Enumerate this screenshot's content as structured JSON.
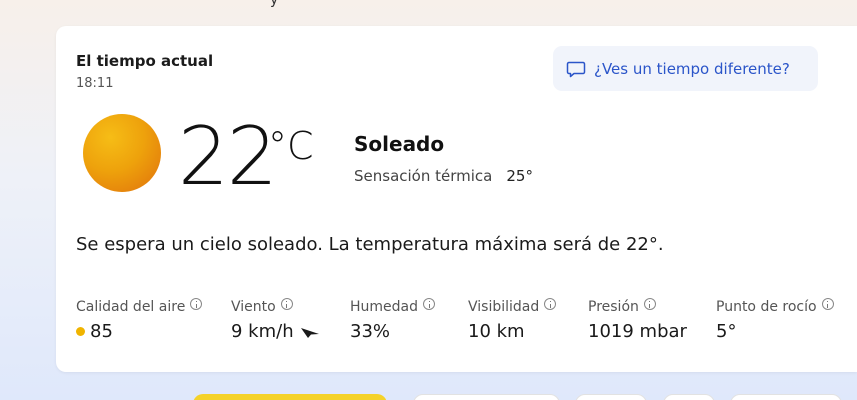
{
  "top_fragment": "y",
  "weather": {
    "title": "El tiempo actual",
    "time": "18:11",
    "feedback_label": "¿Ves un tiempo diferente?",
    "temperature": "22",
    "unit": "°C",
    "condition": "Soleado",
    "feels_like_label": "Sensación térmica",
    "feels_like_value": "25°",
    "summary": "Se espera un cielo soleado. La temperatura máxima será de 22°.",
    "icon": "sun-icon"
  },
  "metrics": [
    {
      "label": "Calidad del aire",
      "value": "85"
    },
    {
      "label": "Viento",
      "value": "9 km/h"
    },
    {
      "label": "Humedad",
      "value": "33%"
    },
    {
      "label": "Visibilidad",
      "value": "10 km"
    },
    {
      "label": "Presión",
      "value": "1019 mbar"
    },
    {
      "label": "Punto de rocío",
      "value": "5°"
    }
  ],
  "colors": {
    "accent": "#2b55c9",
    "aqi_dot": "#f0b400",
    "sun_top": "#f6bd16",
    "sun_bottom": "#e0700c"
  }
}
